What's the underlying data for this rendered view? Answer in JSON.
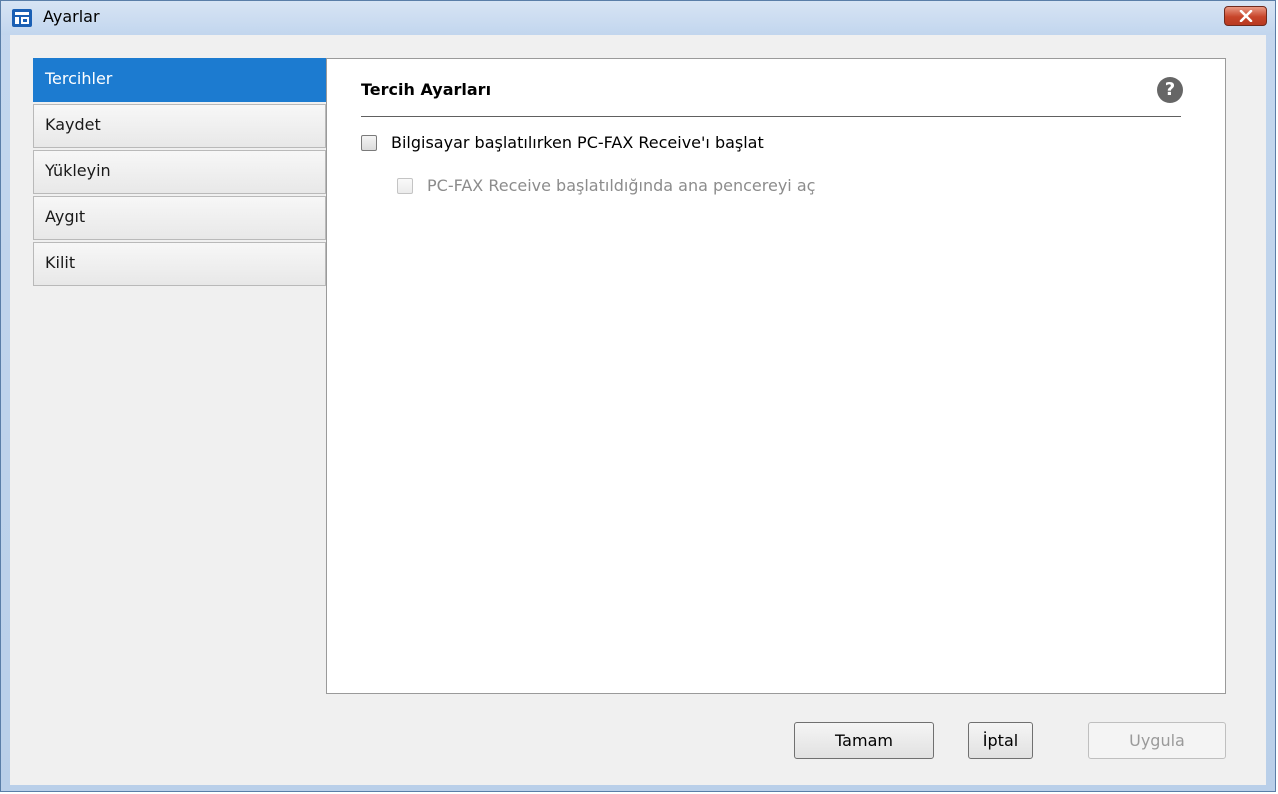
{
  "window": {
    "title": "Ayarlar",
    "close_label": "×"
  },
  "sidebar": {
    "items": [
      {
        "label": "Tercihler",
        "selected": true
      },
      {
        "label": "Kaydet"
      },
      {
        "label": "Yükleyin"
      },
      {
        "label": "Aygıt"
      },
      {
        "label": "Kilit"
      }
    ]
  },
  "panel": {
    "title": "Tercih Ayarları",
    "help_icon": "help-icon",
    "options": [
      {
        "label": "Bilgisayar başlatılırken PC-FAX Receive'ı başlat",
        "checked": false,
        "enabled": true
      },
      {
        "label": "PC-FAX Receive başlatıldığında ana pencereyi aç",
        "checked": false,
        "enabled": false
      }
    ]
  },
  "buttons": {
    "ok": "Tamam",
    "cancel": "İptal",
    "apply": "Uygula"
  },
  "colors": {
    "accent": "#1c7bd0",
    "close": "#c7452a"
  }
}
